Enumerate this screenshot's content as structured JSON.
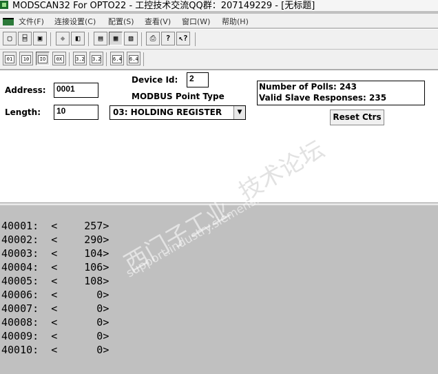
{
  "window": {
    "title": "MODSCAN32 For OPTO22 - 工控技术交流QQ群：207149229 - [无标题]"
  },
  "menu": [
    "文件(F)",
    "连接设置(C)",
    "配置(S)",
    "查看(V)",
    "窗口(W)",
    "帮助(H)"
  ],
  "toolbar": {
    "icons": [
      "new-icon",
      "open-icon",
      "save-icon",
      "connect-icon",
      "disconnect-icon",
      "display-config-icon",
      "show-traffic-icon",
      "test-icon",
      "print-icon",
      "help-icon",
      "context-help-icon"
    ],
    "function_codes": [
      {
        "label": "01",
        "icon": "coil-status-icon"
      },
      {
        "label": "10",
        "icon": "input-status-icon"
      },
      {
        "label": "IO",
        "icon": "holding-register-icon"
      },
      {
        "label": "0X",
        "icon": "input-register-icon"
      },
      {
        "label": "3.2",
        "icon": "write-coil-icon"
      },
      {
        "label": "3.2",
        "icon": "write-register-icon"
      },
      {
        "label": "6.4",
        "icon": "write-multiple-coils-icon"
      },
      {
        "label": "6.4",
        "icon": "write-multiple-registers-icon"
      }
    ]
  },
  "form": {
    "address_label": "Address:",
    "address_value": "0001",
    "length_label": "Length:",
    "length_value": "10",
    "device_id_label": "Device Id:",
    "device_id_value": "2",
    "point_type_label": "MODBUS Point Type",
    "point_type_value": "03: HOLDING REGISTER"
  },
  "stats": {
    "polls": "Number of Polls: 243",
    "responses": "Valid Slave Responses: 235",
    "reset_label": "Reset Ctrs"
  },
  "registers": [
    {
      "address": "40001:",
      "value": "257"
    },
    {
      "address": "40002:",
      "value": "290"
    },
    {
      "address": "40003:",
      "value": "104"
    },
    {
      "address": "40004:",
      "value": "106"
    },
    {
      "address": "40005:",
      "value": "108"
    },
    {
      "address": "40006:",
      "value": "0"
    },
    {
      "address": "40007:",
      "value": "0"
    },
    {
      "address": "40008:",
      "value": "0"
    },
    {
      "address": "40009:",
      "value": "0"
    },
    {
      "address": "40010:",
      "value": "0"
    }
  ],
  "watermark": {
    "line1": "西门子工业",
    "line2": "support.industry.siemens.com/cs",
    "line3": "技术论坛"
  }
}
